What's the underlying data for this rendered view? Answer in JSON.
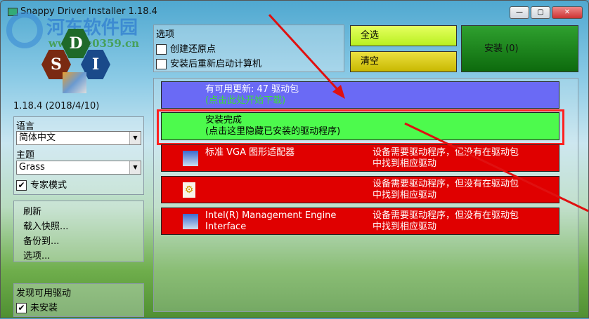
{
  "window": {
    "title": "Snappy Driver Installer 1.18.4",
    "buttons": [
      "—",
      "▢",
      "✕"
    ]
  },
  "watermark": {
    "name": "河东软件园",
    "url": "www.pc0359.cn"
  },
  "logo": {
    "letters": [
      "D",
      "S",
      "I"
    ]
  },
  "version": "1.18.4 (2018/4/10)",
  "language": {
    "label": "语言",
    "value": "简体中文"
  },
  "theme": {
    "label": "主题",
    "value": "Grass"
  },
  "expert_mode": {
    "label": "专家模式",
    "checked": true
  },
  "menu": [
    "刷新",
    "载入快照...",
    "备份到...",
    "选项..."
  ],
  "found": {
    "label": "发现可用驱动",
    "option": "未安装",
    "checked": true
  },
  "options": {
    "label": "选项",
    "items": [
      {
        "label": "创建还原点",
        "checked": false
      },
      {
        "label": "安装后重新启动计算机",
        "checked": false
      }
    ]
  },
  "buttons": {
    "select_all": "全选",
    "clear": "清空",
    "install": "安装 (0)"
  },
  "colors": {
    "update": "#6a6af5",
    "done": "#4dfa4d",
    "error": "#e00000",
    "highlight": "#ff2020"
  },
  "update": {
    "title": "有可用更新: 47 驱动包",
    "sub": "(点击此处开始下载)"
  },
  "done": {
    "title": "安装完成",
    "sub": "(点击这里隐藏已安装的驱动程序)"
  },
  "devices": [
    {
      "name": "标准 VGA 图形适配器",
      "status": "设备需要驱动程序，但没有在驱动包",
      "status2": "中找到相应驱动",
      "icon": "monitor-icon"
    },
    {
      "name": "",
      "status": "设备需要驱动程序，但没有在驱动包",
      "status2": "中找到相应驱动",
      "icon": "settings-file-icon"
    },
    {
      "name": "Intel(R) Management Engine",
      "name2": "Interface",
      "status": "设备需要驱动程序，但没有在驱动包",
      "status2": "中找到相应驱动",
      "icon": "computer-icon"
    }
  ]
}
